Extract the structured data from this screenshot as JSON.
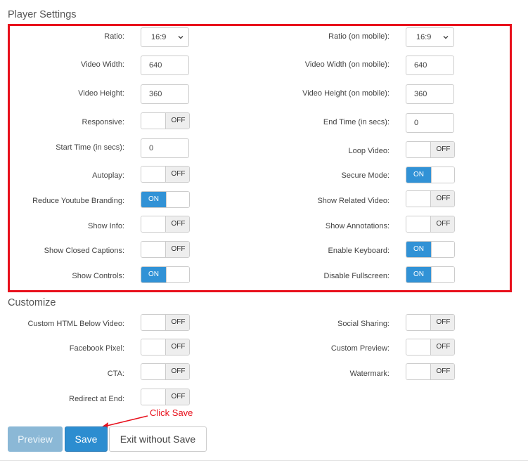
{
  "player_settings": {
    "title": "Player Settings",
    "ratio": {
      "label": "Ratio:",
      "value": "16:9"
    },
    "ratio_mobile": {
      "label": "Ratio (on mobile):",
      "value": "16:9"
    },
    "video_width": {
      "label": "Video Width:",
      "value": "640"
    },
    "video_width_mobile": {
      "label": "Video Width (on mobile):",
      "value": "640"
    },
    "video_height": {
      "label": "Video Height:",
      "value": "360"
    },
    "video_height_mobile": {
      "label": "Video Height (on mobile):",
      "value": "360"
    },
    "responsive": {
      "label": "Responsive:",
      "state": "OFF"
    },
    "end_time": {
      "label": "End Time (in secs):",
      "value": "0"
    },
    "start_time": {
      "label": "Start Time (in secs):",
      "value": "0"
    },
    "loop_video": {
      "label": "Loop Video:",
      "state": "OFF"
    },
    "autoplay": {
      "label": "Autoplay:",
      "state": "OFF"
    },
    "secure_mode": {
      "label": "Secure Mode:",
      "state": "ON"
    },
    "reduce_branding": {
      "label": "Reduce Youtube Branding:",
      "state": "ON"
    },
    "show_related": {
      "label": "Show Related Video:",
      "state": "OFF"
    },
    "show_info": {
      "label": "Show Info:",
      "state": "OFF"
    },
    "show_annotations": {
      "label": "Show Annotations:",
      "state": "OFF"
    },
    "show_captions": {
      "label": "Show Closed Captions:",
      "state": "OFF"
    },
    "enable_keyboard": {
      "label": "Enable Keyboard:",
      "state": "ON"
    },
    "show_controls": {
      "label": "Show Controls:",
      "state": "ON"
    },
    "disable_fullscreen": {
      "label": "Disable Fullscreen:",
      "state": "ON"
    }
  },
  "customize": {
    "title": "Customize",
    "custom_html": {
      "label": "Custom HTML Below Video:",
      "state": "OFF"
    },
    "social_sharing": {
      "label": "Social Sharing:",
      "state": "OFF"
    },
    "facebook_pixel": {
      "label": "Facebook Pixel:",
      "state": "OFF"
    },
    "custom_preview": {
      "label": "Custom Preview:",
      "state": "OFF"
    },
    "cta": {
      "label": "CTA:",
      "state": "OFF"
    },
    "watermark": {
      "label": "Watermark:",
      "state": "OFF"
    },
    "redirect_end": {
      "label": "Redirect at End:",
      "state": "OFF"
    }
  },
  "actions": {
    "preview_label": "Preview",
    "save_label": "Save",
    "exit_label": "Exit without Save"
  },
  "annotation": {
    "text": "Click Save"
  },
  "colors": {
    "accent": "#2c8dd0",
    "toggle_on": "#3192d6",
    "highlight": "#e8101c"
  }
}
